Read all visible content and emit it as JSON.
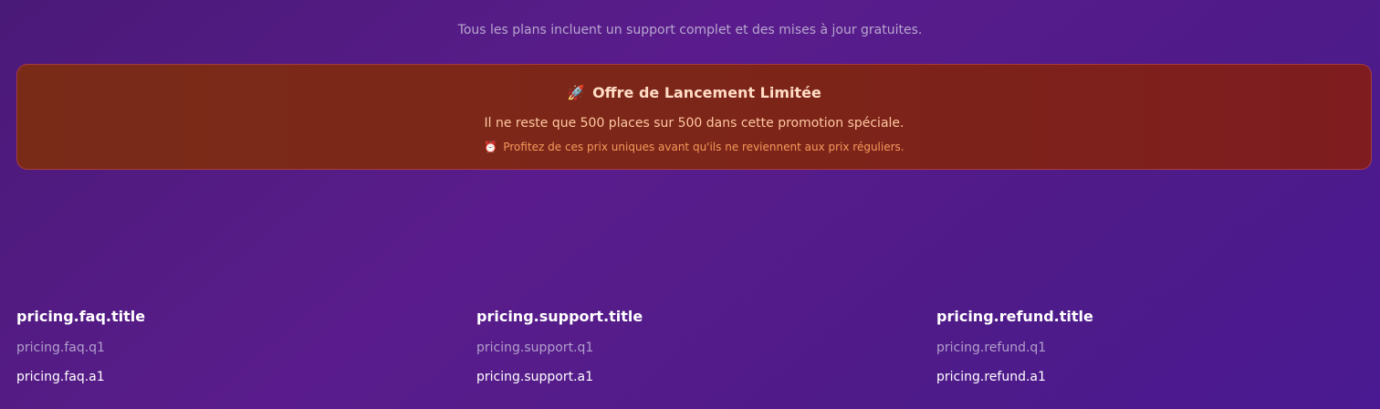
{
  "subtitle": "Tous les plans incluent un support complet et des mises à jour gratuites.",
  "promo": {
    "icon": "rocket-icon",
    "title": "Offre de Lancement Limitée",
    "message": "Il ne reste que 500 places sur 500 dans cette promotion spéciale.",
    "note_icon": "alarm-clock-icon",
    "note": "Profitez de ces prix uniques avant qu'ils ne reviennent aux prix réguliers."
  },
  "columns": [
    {
      "title": "pricing.faq.title",
      "question": "pricing.faq.q1",
      "answer": "pricing.faq.a1"
    },
    {
      "title": "pricing.support.title",
      "question": "pricing.support.q1",
      "answer": "pricing.support.a1"
    },
    {
      "title": "pricing.refund.title",
      "question": "pricing.refund.q1",
      "answer": "pricing.refund.a1"
    }
  ]
}
